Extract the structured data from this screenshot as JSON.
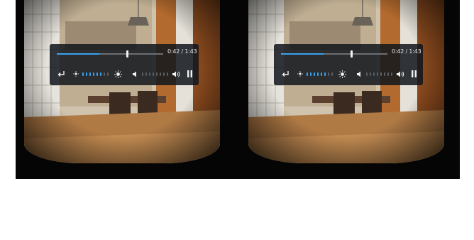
{
  "colors": {
    "accent": "#3aa2ef",
    "panel_bg": "#12161c",
    "lens_frame": "#050505"
  },
  "eyes": [
    {
      "id": "left",
      "player": {
        "time_label": "0:42 / 1:43",
        "progress_fraction": 0.4,
        "brightness_level_fraction": 0.6,
        "volume_level_fraction": 0.0,
        "icons": [
          "back-icon",
          "brightness-low-icon",
          "brightness-high-icon",
          "volume-low-icon",
          "volume-high-icon",
          "pause-icon"
        ]
      }
    },
    {
      "id": "right",
      "player": {
        "time_label": "0:42 / 1:43",
        "progress_fraction": 0.4,
        "brightness_level_fraction": 0.6,
        "volume_level_fraction": 0.0,
        "icons": [
          "back-icon",
          "brightness-low-icon",
          "brightness-high-icon",
          "volume-low-icon",
          "volume-high-icon",
          "pause-icon"
        ]
      }
    }
  ]
}
